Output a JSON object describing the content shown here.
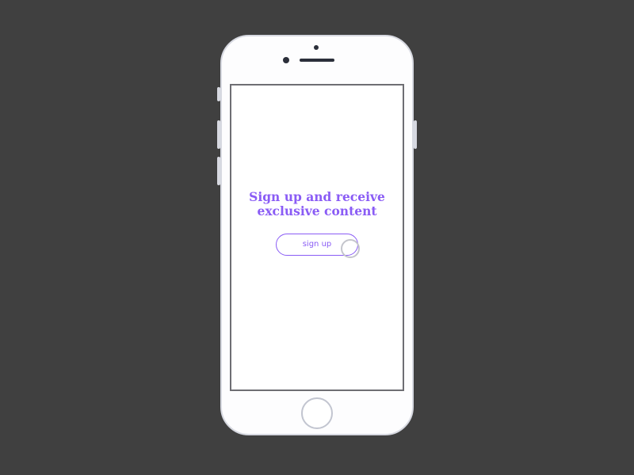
{
  "screen": {
    "headline_line1": "Sign up and receive",
    "headline_line2": "exclusive content",
    "signup_button_label": "sign up"
  },
  "colors": {
    "background": "#404040",
    "accent": "#8a5cf5",
    "device_body": "#fdfdfe",
    "device_border": "#d7d9e1"
  },
  "icons": {
    "touch_indicator": "touch-cursor-icon",
    "home_button": "home-button-icon"
  }
}
